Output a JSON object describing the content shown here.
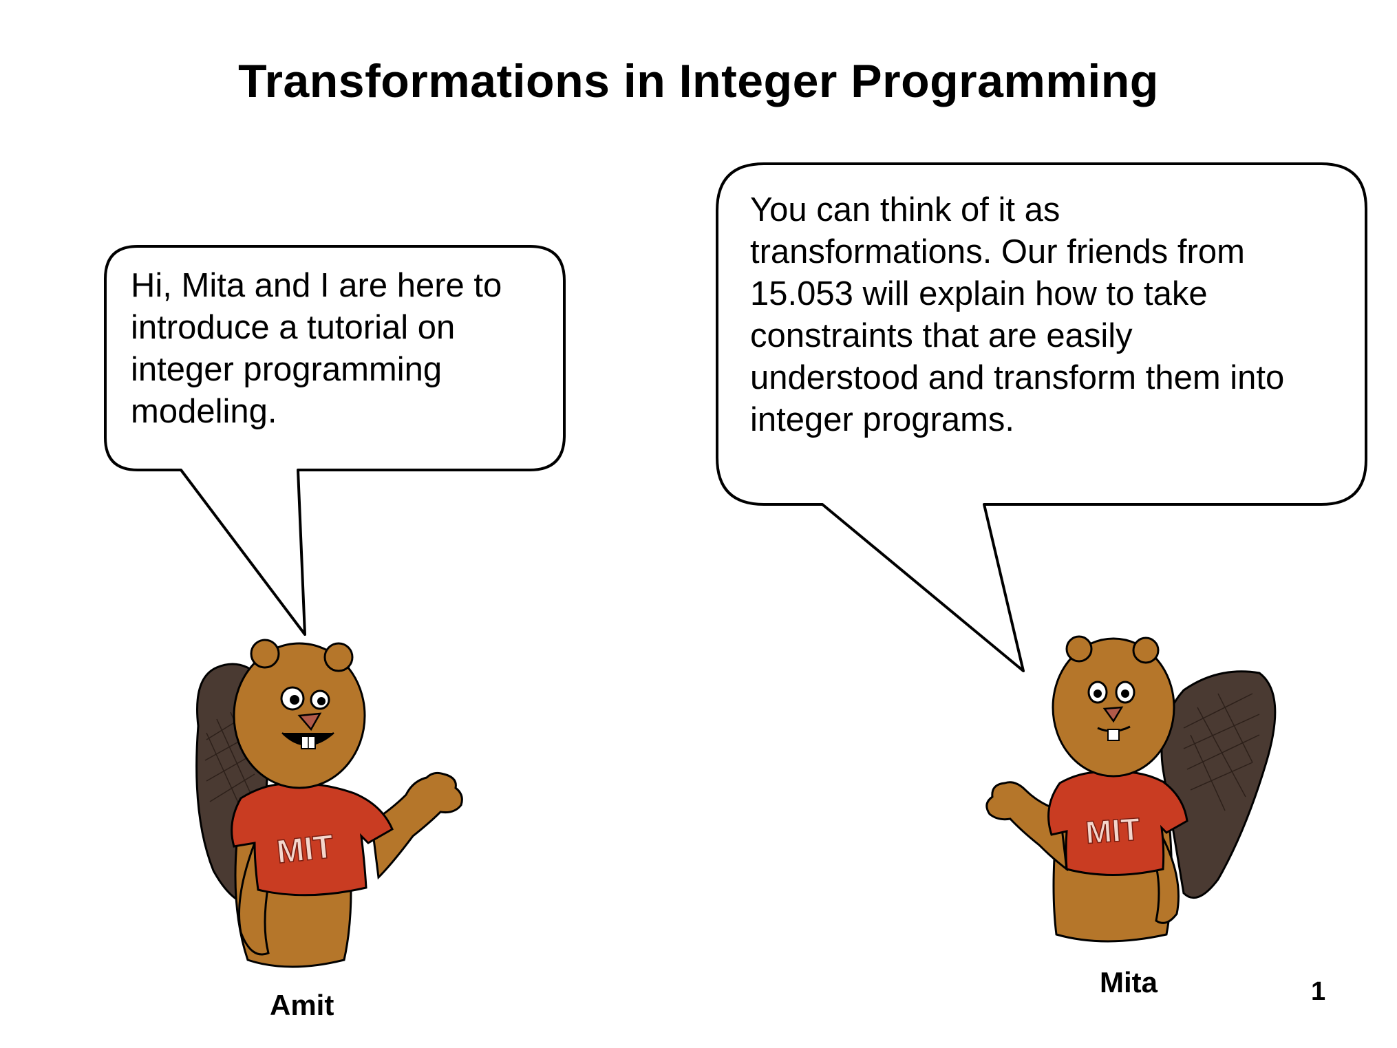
{
  "title": "Transformations in Integer Programming",
  "left_bubble": {
    "text": "Hi,  Mita and I are here to\nintroduce a tutorial on\ninteger programming\nmodeling."
  },
  "right_bubble": {
    "text": "You can think of it as\ntransformations.  Our friends from\n15.053 will explain how to take\nconstraints that are easily\nunderstood and transform them into\ninteger programs."
  },
  "characters": [
    {
      "name": "Amit",
      "shirt_text": "MIT"
    },
    {
      "name": "Mita",
      "shirt_text": "MIT"
    }
  ],
  "page_number": "1",
  "colors": {
    "fur": "#b5762a",
    "fur_dark": "#8a5518",
    "tail": "#4a3a32",
    "shirt": "#c93c22",
    "outline": "#000000",
    "background": "#ffffff"
  }
}
